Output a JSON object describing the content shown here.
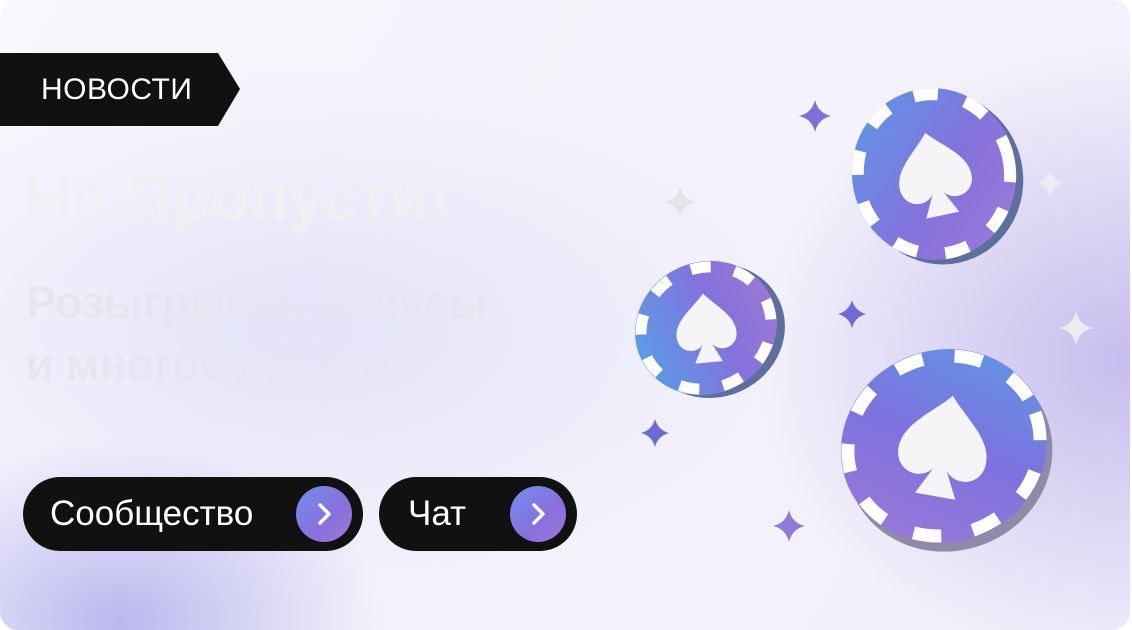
{
  "banner": {
    "tag_label": "НОВОСТИ",
    "headline": "Не Пропусти!",
    "subline_1": "Розыгрыши, бонусы",
    "subline_2": "и многое другое"
  },
  "buttons": {
    "community_label": "Сообщество",
    "chat_label": "Чат"
  },
  "colors": {
    "pill_bg": "#111111",
    "chip_blue": "#5b9be8",
    "chip_violet": "#8a6fdc",
    "chip_purple": "#a07ad6",
    "sparkle_violet": "#7b6fdc",
    "sparkle_white": "#e8e8ec"
  },
  "icons": [
    "chevron-right-icon",
    "poker-chip-icon",
    "spade-icon",
    "sparkle-icon"
  ]
}
